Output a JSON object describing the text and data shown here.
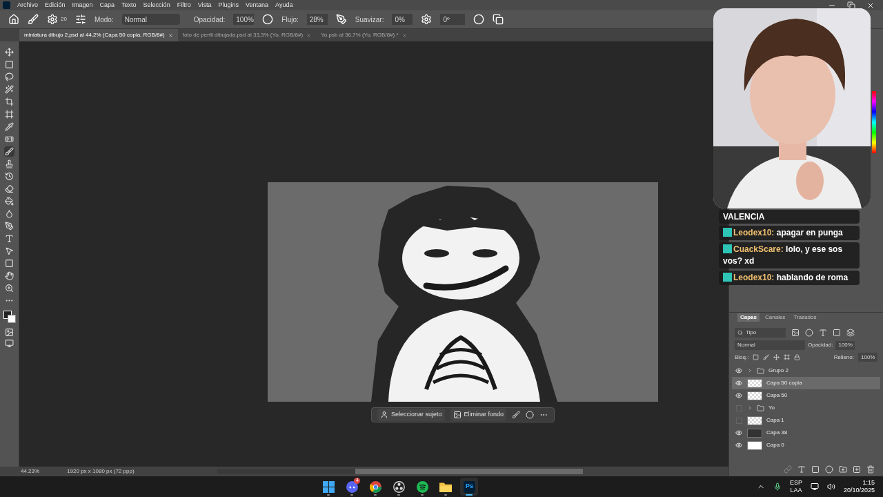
{
  "menu": [
    "Archivo",
    "Edición",
    "Imagen",
    "Capa",
    "Texto",
    "Selección",
    "Filtro",
    "Vista",
    "Plugins",
    "Ventana",
    "Ayuda"
  ],
  "options_bar": {
    "brush_size": "20",
    "mode_label": "Modo:",
    "mode": "Normal",
    "opacity_label": "Opacidad:",
    "opacity": "100%",
    "flow_label": "Flujo:",
    "flow": "28%",
    "smoothing_label": "Suavizar:",
    "smoothing": "0%",
    "angle": "0º"
  },
  "tabs": [
    {
      "label": "miniatura dibujo 2.psd al 44,2% (Capa 50 copia, RGB/8#)",
      "selected": true
    },
    {
      "label": "foto de perfil dibujada.psd al 33,3% (Yo, RGB/8#)",
      "selected": false
    },
    {
      "label": "Yo.psb al 36,7% (Yo, RGB/8#) *",
      "selected": false
    }
  ],
  "contextual_bar": {
    "buttons": [
      "Seleccionar sujeto",
      "Eliminar fondo"
    ]
  },
  "status_bar": {
    "zoom": "44.23%",
    "document": "1920 px x 1080 px (72 ppp)"
  },
  "chat": {
    "title": "VALENCIA",
    "messages": [
      {
        "user": "Leodex10:",
        "text": "apagar en punga"
      },
      {
        "user": "CuackScare:",
        "text": "lolo, y ese sos vos? xd"
      },
      {
        "user": "Leodex10:",
        "text": "hablando de roma"
      }
    ]
  },
  "layers_panel": {
    "tabs": [
      {
        "label": "Capas",
        "selected": true
      },
      {
        "label": "Canales",
        "selected": false
      },
      {
        "label": "Trazados",
        "selected": false
      }
    ],
    "filter": "Tipo",
    "blend_mode": "Normal",
    "opacity_label": "Opacidad:",
    "opacity": "100%",
    "lock_label": "Bloq.:",
    "fill_label": "Relleno:",
    "fill": "100%",
    "layers": [
      {
        "name": "Grupo 2",
        "kind": "group",
        "visible": true,
        "selected": false
      },
      {
        "name": "Capa 50 copia",
        "kind": "transparent",
        "visible": true,
        "selected": true
      },
      {
        "name": "Capa 50",
        "kind": "transparent",
        "visible": true,
        "selected": false
      },
      {
        "name": "Yo",
        "kind": "group",
        "visible": false,
        "selected": false
      },
      {
        "name": "Capa 1",
        "kind": "transparent",
        "visible": false,
        "selected": false
      },
      {
        "name": "Capa 38",
        "kind": "dark",
        "visible": true,
        "selected": false
      },
      {
        "name": "Capa 0",
        "kind": "white",
        "visible": true,
        "selected": false
      }
    ]
  },
  "taskbar": {
    "apps": [
      {
        "kind": "start",
        "active": false
      },
      {
        "kind": "discord",
        "badge": "4",
        "active": false
      },
      {
        "kind": "chrome",
        "active": false
      },
      {
        "kind": "obs",
        "active": false
      },
      {
        "kind": "spotify",
        "active": false
      },
      {
        "kind": "folder",
        "active": false
      },
      {
        "kind": "photoshop",
        "label": "Ps",
        "active": true
      }
    ],
    "language": "ESP",
    "layout": "LAA",
    "time": "1:15",
    "date": "20/10/2025"
  }
}
